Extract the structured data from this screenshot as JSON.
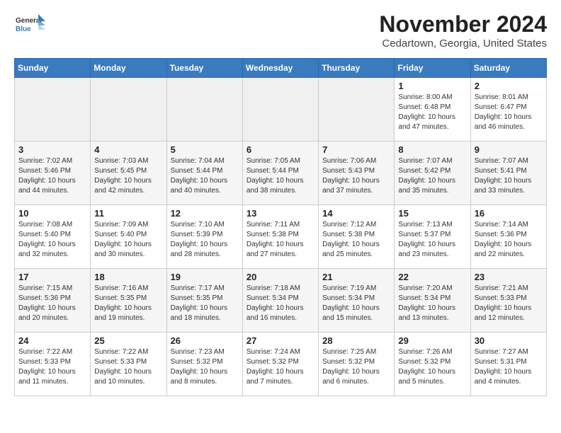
{
  "logo": {
    "general": "General",
    "blue": "Blue"
  },
  "header": {
    "month": "November 2024",
    "location": "Cedartown, Georgia, United States"
  },
  "weekdays": [
    "Sunday",
    "Monday",
    "Tuesday",
    "Wednesday",
    "Thursday",
    "Friday",
    "Saturday"
  ],
  "weeks": [
    [
      {
        "day": "",
        "info": ""
      },
      {
        "day": "",
        "info": ""
      },
      {
        "day": "",
        "info": ""
      },
      {
        "day": "",
        "info": ""
      },
      {
        "day": "",
        "info": ""
      },
      {
        "day": "1",
        "info": "Sunrise: 8:00 AM\nSunset: 6:48 PM\nDaylight: 10 hours and 47 minutes."
      },
      {
        "day": "2",
        "info": "Sunrise: 8:01 AM\nSunset: 6:47 PM\nDaylight: 10 hours and 46 minutes."
      }
    ],
    [
      {
        "day": "3",
        "info": "Sunrise: 7:02 AM\nSunset: 5:46 PM\nDaylight: 10 hours and 44 minutes."
      },
      {
        "day": "4",
        "info": "Sunrise: 7:03 AM\nSunset: 5:45 PM\nDaylight: 10 hours and 42 minutes."
      },
      {
        "day": "5",
        "info": "Sunrise: 7:04 AM\nSunset: 5:44 PM\nDaylight: 10 hours and 40 minutes."
      },
      {
        "day": "6",
        "info": "Sunrise: 7:05 AM\nSunset: 5:44 PM\nDaylight: 10 hours and 38 minutes."
      },
      {
        "day": "7",
        "info": "Sunrise: 7:06 AM\nSunset: 5:43 PM\nDaylight: 10 hours and 37 minutes."
      },
      {
        "day": "8",
        "info": "Sunrise: 7:07 AM\nSunset: 5:42 PM\nDaylight: 10 hours and 35 minutes."
      },
      {
        "day": "9",
        "info": "Sunrise: 7:07 AM\nSunset: 5:41 PM\nDaylight: 10 hours and 33 minutes."
      }
    ],
    [
      {
        "day": "10",
        "info": "Sunrise: 7:08 AM\nSunset: 5:40 PM\nDaylight: 10 hours and 32 minutes."
      },
      {
        "day": "11",
        "info": "Sunrise: 7:09 AM\nSunset: 5:40 PM\nDaylight: 10 hours and 30 minutes."
      },
      {
        "day": "12",
        "info": "Sunrise: 7:10 AM\nSunset: 5:39 PM\nDaylight: 10 hours and 28 minutes."
      },
      {
        "day": "13",
        "info": "Sunrise: 7:11 AM\nSunset: 5:38 PM\nDaylight: 10 hours and 27 minutes."
      },
      {
        "day": "14",
        "info": "Sunrise: 7:12 AM\nSunset: 5:38 PM\nDaylight: 10 hours and 25 minutes."
      },
      {
        "day": "15",
        "info": "Sunrise: 7:13 AM\nSunset: 5:37 PM\nDaylight: 10 hours and 23 minutes."
      },
      {
        "day": "16",
        "info": "Sunrise: 7:14 AM\nSunset: 5:36 PM\nDaylight: 10 hours and 22 minutes."
      }
    ],
    [
      {
        "day": "17",
        "info": "Sunrise: 7:15 AM\nSunset: 5:36 PM\nDaylight: 10 hours and 20 minutes."
      },
      {
        "day": "18",
        "info": "Sunrise: 7:16 AM\nSunset: 5:35 PM\nDaylight: 10 hours and 19 minutes."
      },
      {
        "day": "19",
        "info": "Sunrise: 7:17 AM\nSunset: 5:35 PM\nDaylight: 10 hours and 18 minutes."
      },
      {
        "day": "20",
        "info": "Sunrise: 7:18 AM\nSunset: 5:34 PM\nDaylight: 10 hours and 16 minutes."
      },
      {
        "day": "21",
        "info": "Sunrise: 7:19 AM\nSunset: 5:34 PM\nDaylight: 10 hours and 15 minutes."
      },
      {
        "day": "22",
        "info": "Sunrise: 7:20 AM\nSunset: 5:34 PM\nDaylight: 10 hours and 13 minutes."
      },
      {
        "day": "23",
        "info": "Sunrise: 7:21 AM\nSunset: 5:33 PM\nDaylight: 10 hours and 12 minutes."
      }
    ],
    [
      {
        "day": "24",
        "info": "Sunrise: 7:22 AM\nSunset: 5:33 PM\nDaylight: 10 hours and 11 minutes."
      },
      {
        "day": "25",
        "info": "Sunrise: 7:22 AM\nSunset: 5:33 PM\nDaylight: 10 hours and 10 minutes."
      },
      {
        "day": "26",
        "info": "Sunrise: 7:23 AM\nSunset: 5:32 PM\nDaylight: 10 hours and 8 minutes."
      },
      {
        "day": "27",
        "info": "Sunrise: 7:24 AM\nSunset: 5:32 PM\nDaylight: 10 hours and 7 minutes."
      },
      {
        "day": "28",
        "info": "Sunrise: 7:25 AM\nSunset: 5:32 PM\nDaylight: 10 hours and 6 minutes."
      },
      {
        "day": "29",
        "info": "Sunrise: 7:26 AM\nSunset: 5:32 PM\nDaylight: 10 hours and 5 minutes."
      },
      {
        "day": "30",
        "info": "Sunrise: 7:27 AM\nSunset: 5:31 PM\nDaylight: 10 hours and 4 minutes."
      }
    ]
  ]
}
